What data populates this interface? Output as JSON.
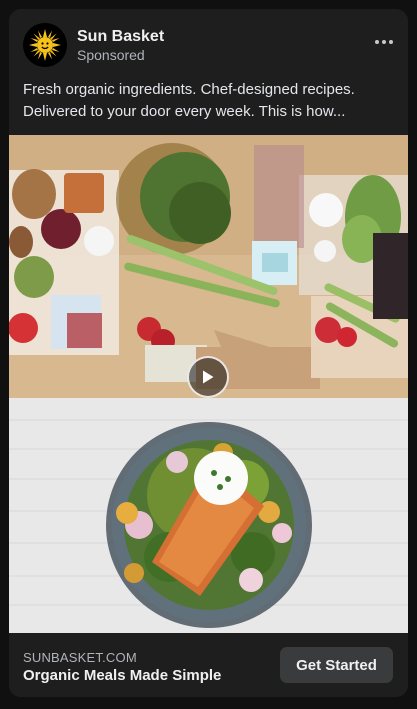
{
  "ad": {
    "brand_name": "Sun Basket",
    "sponsored_label": "Sponsored",
    "caption": "Fresh organic ingredients. Chef-designed recipes. Delivered to your door every week. This is how...",
    "domain": "SUNBASKET.COM",
    "headline": "Organic Meals Made Simple",
    "cta_label": "Get Started"
  },
  "icons": {
    "avatar": "sun-logo-icon",
    "more": "more-options-icon",
    "play": "play-icon"
  },
  "colors": {
    "background": "#101010",
    "card": "#1e1e1f",
    "cta": "#3a3b3c",
    "logo": "#f6c21a"
  }
}
